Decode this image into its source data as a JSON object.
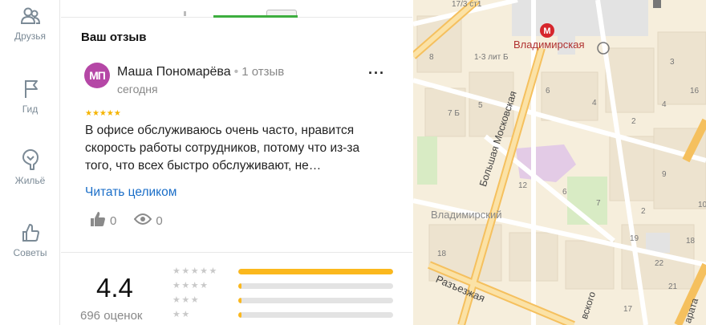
{
  "sidebar": {
    "items": [
      {
        "label": "Друзья",
        "icon": "friends-icon"
      },
      {
        "label": "Гид",
        "icon": "flag-icon"
      },
      {
        "label": "Жильё",
        "icon": "house-icon"
      },
      {
        "label": "Советы",
        "icon": "thumb-up-icon"
      }
    ]
  },
  "review": {
    "section_title": "Ваш отзыв",
    "avatar_initials": "МП",
    "author": "Маша Пономарёва",
    "author_review_count": "1 отзыв",
    "date": "сегодня",
    "rating": 5,
    "text": "В офисе обслуживаюсь очень часто, нравится скорость работы сотрудников, потому что из-за того, что всех быстро обслуживают, не…",
    "read_more": "Читать целиком",
    "likes": "0",
    "views": "0"
  },
  "summary": {
    "score": "4.4",
    "count_label": "696 оценок",
    "distribution": [
      {
        "stars": 5,
        "fraction": 1.0
      },
      {
        "stars": 4,
        "fraction": 0.02
      },
      {
        "stars": 3,
        "fraction": 0.02
      },
      {
        "stars": 2,
        "fraction": 0.02
      }
    ]
  },
  "map": {
    "labels": {
      "metro": "Владимирская",
      "street_main": "Большая Московская",
      "district": "Владимирский",
      "street_razezzhaya": "Разъезжая",
      "street_partial_1": "вского",
      "street_partial_2": "арата",
      "top_address": "17/3 ст1",
      "addr_1_3": "1-3 лит Б"
    },
    "house_numbers": [
      "8",
      "6",
      "7 Б",
      "5",
      "4",
      "2",
      "12",
      "9",
      "6",
      "7",
      "18",
      "19",
      "17",
      "21",
      "22",
      "18",
      "16",
      "4",
      "3",
      "2",
      "10"
    ],
    "accent_color": "#fbb81d",
    "metro_color": "#d6262c"
  }
}
